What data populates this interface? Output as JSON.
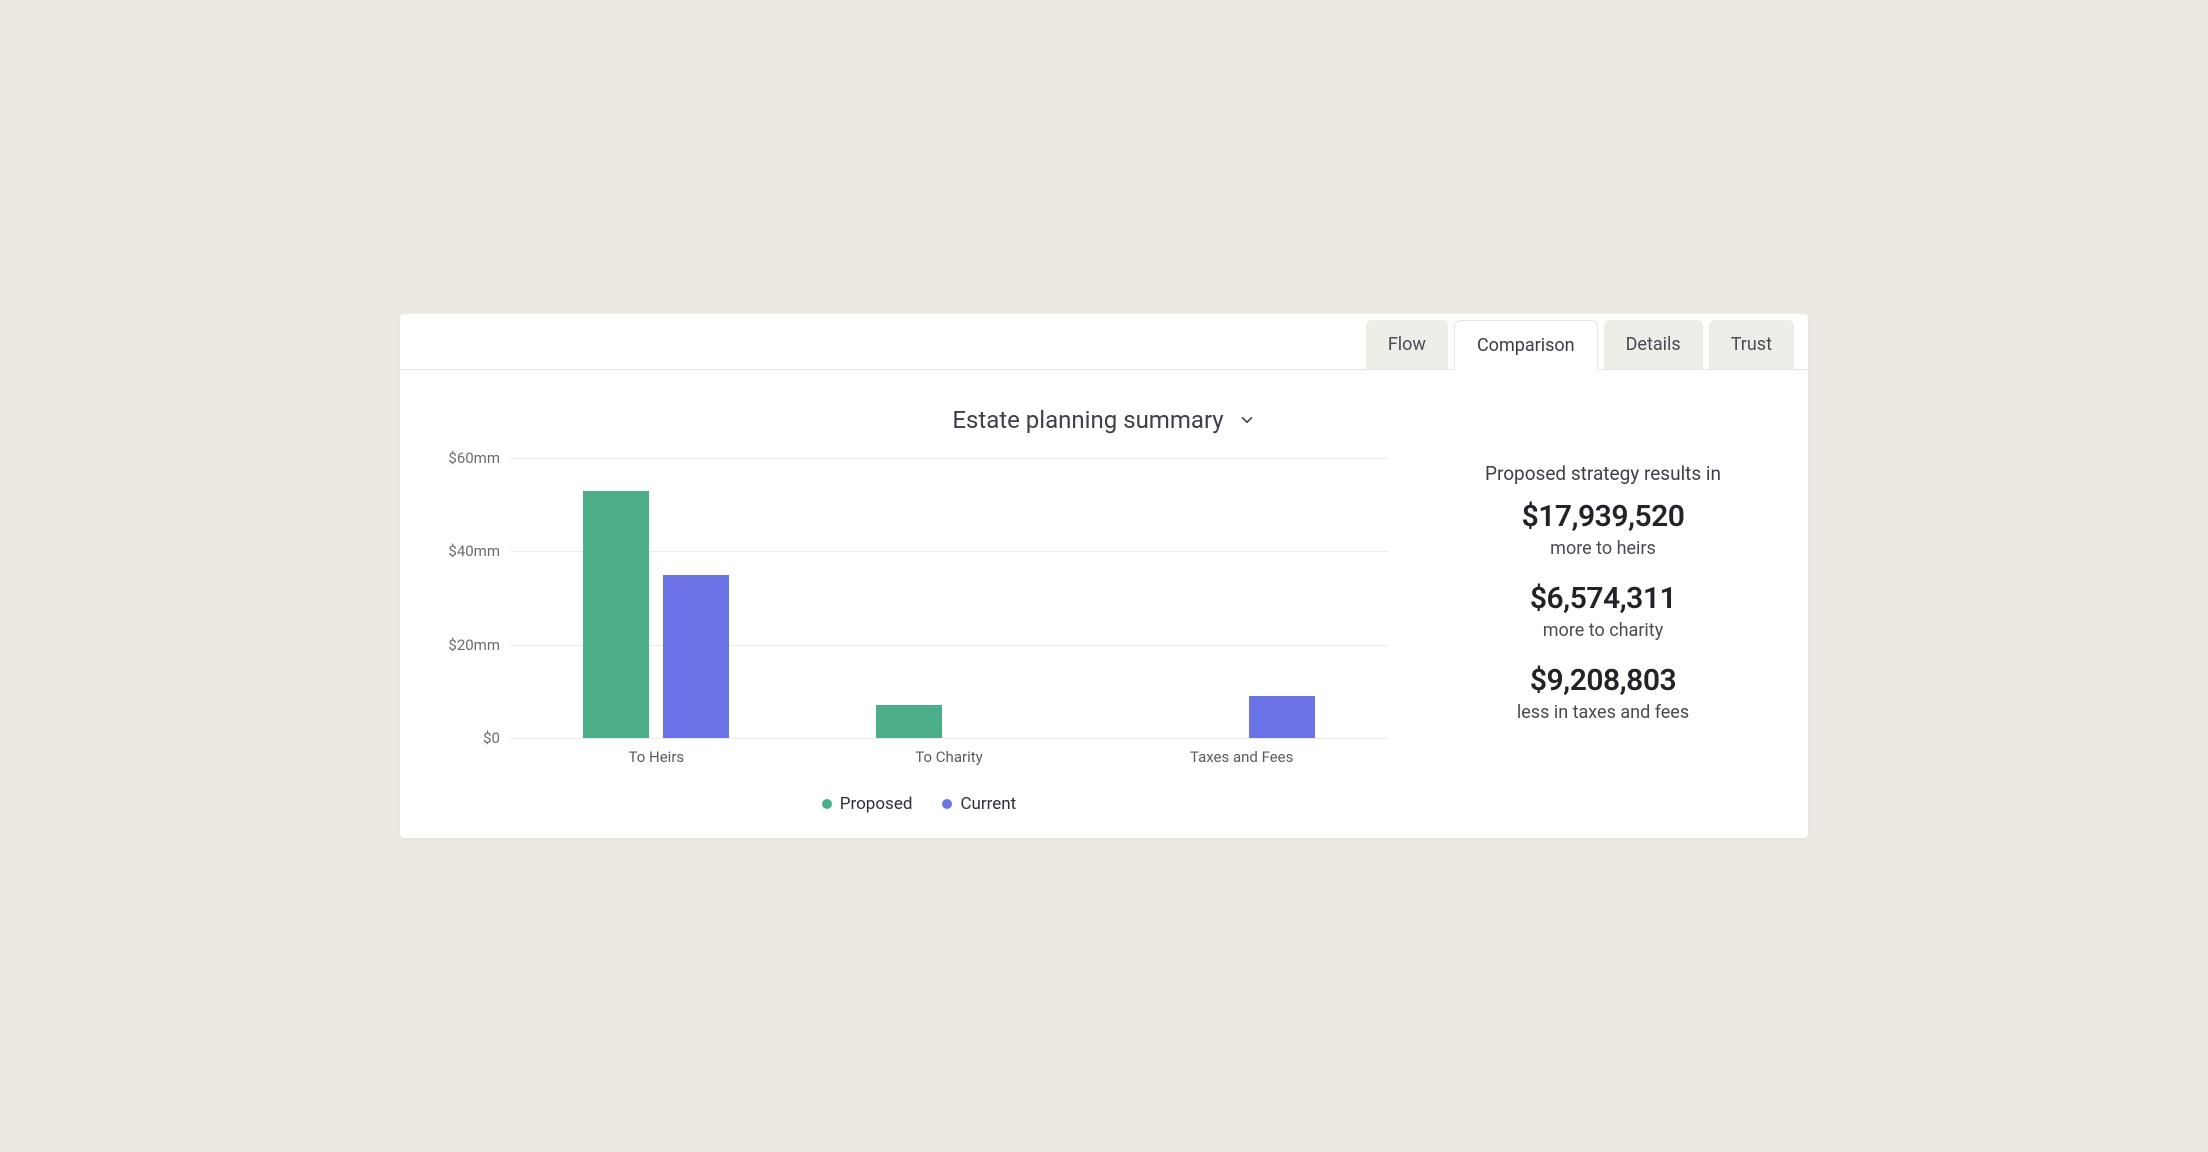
{
  "tabs": [
    {
      "label": "Flow",
      "active": false
    },
    {
      "label": "Comparison",
      "active": true
    },
    {
      "label": "Details",
      "active": false
    },
    {
      "label": "Trust",
      "active": false
    }
  ],
  "title": "Estate planning summary",
  "chart_data": {
    "type": "bar",
    "categories": [
      "To Heirs",
      "To Charity",
      "Taxes and Fees"
    ],
    "series": [
      {
        "name": "Proposed",
        "color": "#4cae89",
        "values": [
          53,
          7,
          0
        ]
      },
      {
        "name": "Current",
        "color": "#6a74e6",
        "values": [
          35,
          0,
          9
        ]
      }
    ],
    "ylim": [
      0,
      60
    ],
    "yticks": [
      0,
      20,
      40,
      60
    ],
    "ytick_labels": [
      "$0",
      "$20mm",
      "$40mm",
      "$60mm"
    ]
  },
  "summary": {
    "lead": "Proposed strategy results in",
    "items": [
      {
        "amount": "$17,939,520",
        "desc": "more to heirs"
      },
      {
        "amount": "$6,574,311",
        "desc": "more to charity"
      },
      {
        "amount": "$9,208,803",
        "desc": "less in taxes and fees"
      }
    ]
  }
}
